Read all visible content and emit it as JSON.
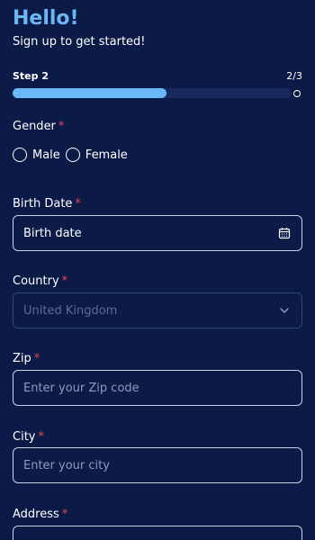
{
  "header": {
    "title": "Hello!",
    "subtitle": "Sign up to get started!"
  },
  "progress": {
    "step_label": "Step 2",
    "step_count": "2/3",
    "fraction": 0.55
  },
  "fields": {
    "gender": {
      "label": "Gender",
      "required_mark": "*",
      "options": [
        "Male",
        "Female"
      ]
    },
    "birth_date": {
      "label": "Birth Date",
      "required_mark": "*",
      "value": "Birth date",
      "icon": "calendar-icon"
    },
    "country": {
      "label": "Country",
      "required_mark": "*",
      "value": "United Kingdom",
      "icon": "chevron-down-icon"
    },
    "zip": {
      "label": "Zip",
      "required_mark": "*",
      "placeholder": "Enter your Zip code"
    },
    "city": {
      "label": "City",
      "required_mark": "*",
      "placeholder": "Enter your city"
    },
    "address": {
      "label": "Address",
      "required_mark": "*"
    }
  },
  "colors": {
    "background": "#0b1a47",
    "accent": "#6ab8f7",
    "required": "#e5484d"
  }
}
